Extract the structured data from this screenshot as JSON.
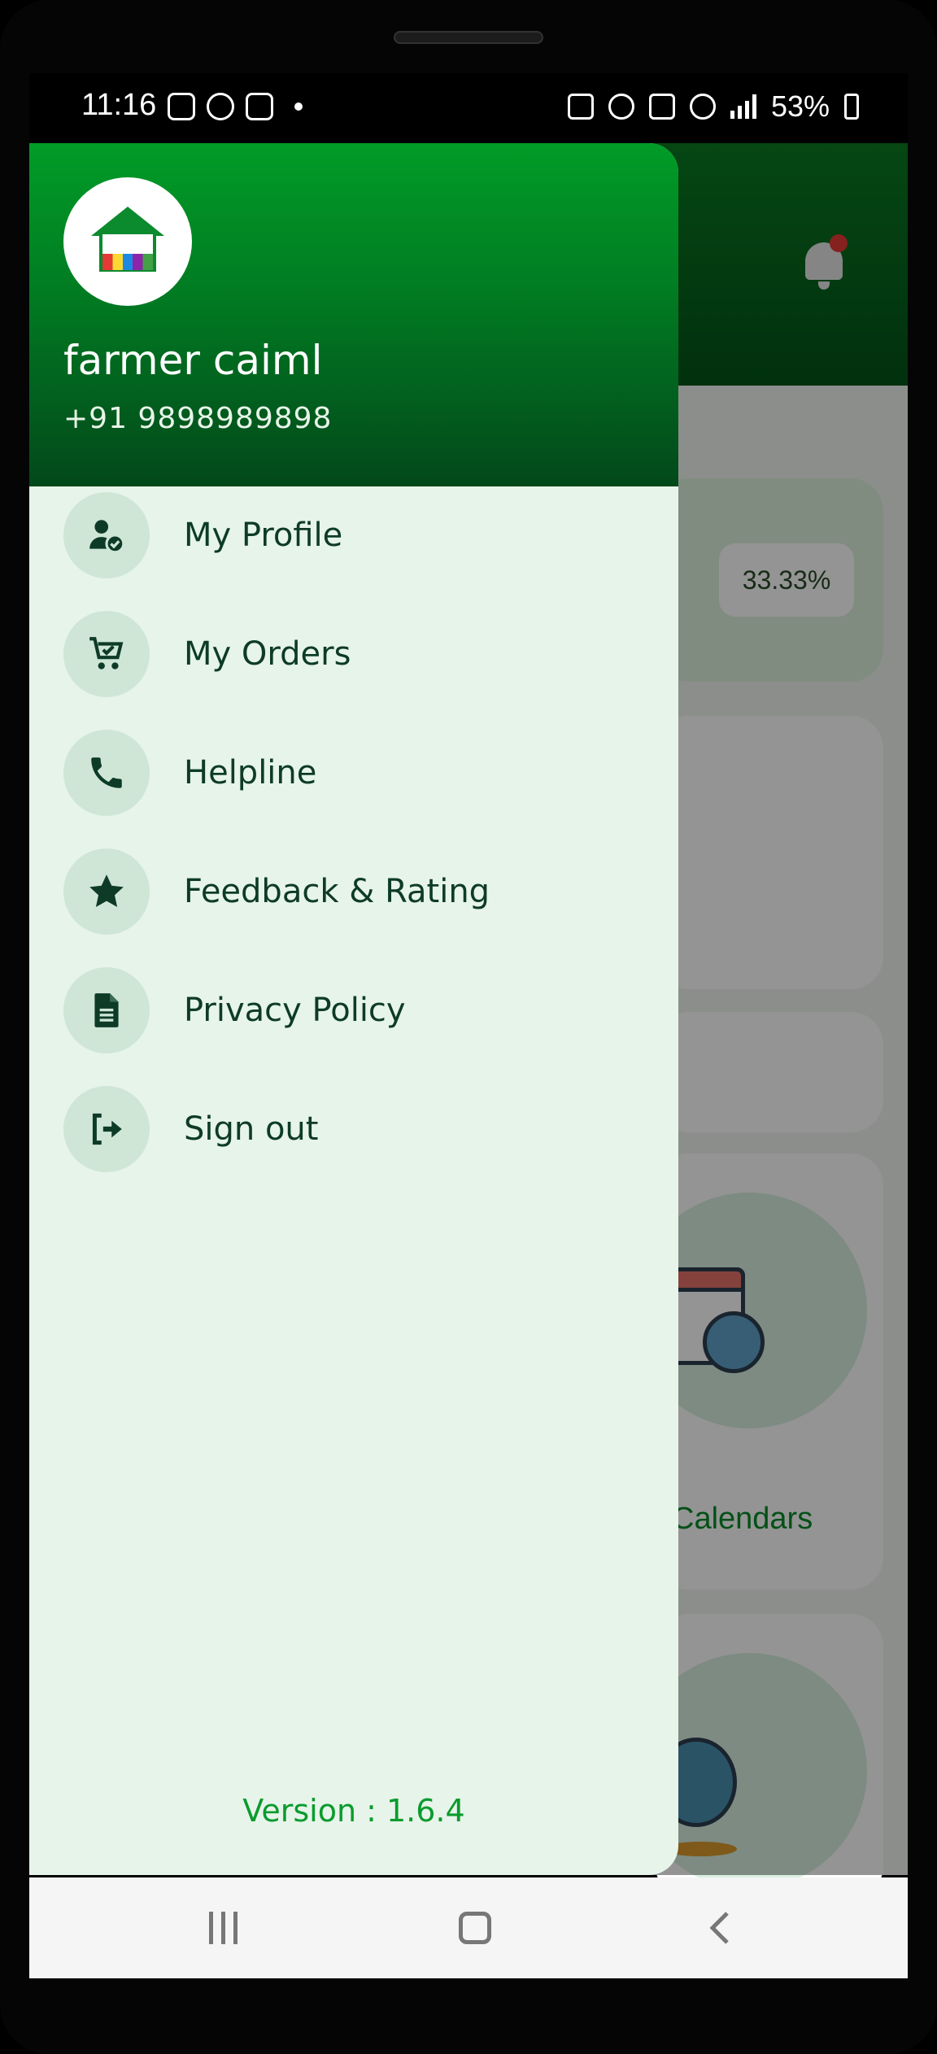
{
  "status_bar": {
    "time": "11:16",
    "battery": "53%"
  },
  "background_app": {
    "progress_percent": "33.33%",
    "calendars_label": "Calendars"
  },
  "drawer": {
    "user_name": "farmer caiml",
    "user_phone": "+91 9898989898",
    "menu": [
      {
        "label": "My Profile",
        "icon": "user-check-icon"
      },
      {
        "label": "My Orders",
        "icon": "cart-check-icon"
      },
      {
        "label": "Helpline",
        "icon": "phone-icon"
      },
      {
        "label": "Feedback & Rating",
        "icon": "star-icon"
      },
      {
        "label": "Privacy Policy",
        "icon": "document-icon"
      },
      {
        "label": "Sign out",
        "icon": "sign-out-icon"
      }
    ],
    "version": "Version : 1.6.4"
  },
  "colors": {
    "header_green": "#019c27",
    "drawer_bg": "#e7f4ea",
    "menu_text": "#0d3b27",
    "version_green": "#0a9b2d"
  }
}
